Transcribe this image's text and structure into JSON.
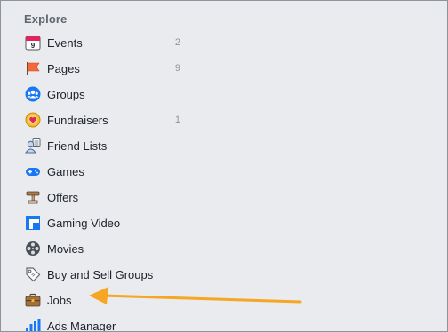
{
  "explore": {
    "title": "Explore",
    "items": [
      {
        "label": "Events",
        "count": "2",
        "icon": "calendar-icon"
      },
      {
        "label": "Pages",
        "count": "9",
        "icon": "flag-icon"
      },
      {
        "label": "Groups",
        "count": "",
        "icon": "groups-icon"
      },
      {
        "label": "Fundraisers",
        "count": "1",
        "icon": "heart-coin-icon"
      },
      {
        "label": "Friend Lists",
        "count": "",
        "icon": "friend-list-icon"
      },
      {
        "label": "Games",
        "count": "",
        "icon": "gamepad-icon"
      },
      {
        "label": "Offers",
        "count": "",
        "icon": "offers-tag-icon"
      },
      {
        "label": "Gaming Video",
        "count": "",
        "icon": "gaming-video-icon"
      },
      {
        "label": "Movies",
        "count": "",
        "icon": "film-reel-icon"
      },
      {
        "label": "Buy and Sell Groups",
        "count": "",
        "icon": "price-tag-icon"
      },
      {
        "label": "Jobs",
        "count": "",
        "icon": "briefcase-icon"
      },
      {
        "label": "Ads Manager",
        "count": "",
        "icon": "bar-chart-icon"
      }
    ]
  },
  "annotation": {
    "color": "#f5a623",
    "points_to": "Jobs"
  }
}
